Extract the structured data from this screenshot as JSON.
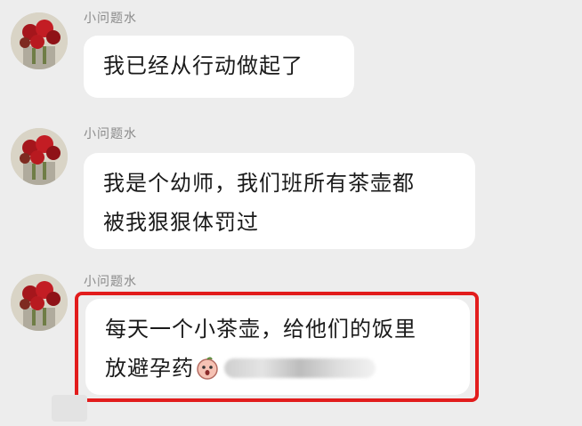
{
  "messages": [
    {
      "sender": "小问题水",
      "lines": [
        "我已经从行动做起了"
      ]
    },
    {
      "sender": "小问题水",
      "lines": [
        "我是个幼师，我们班所有茶壶都",
        "被我狠狠体罚过"
      ]
    },
    {
      "sender": "小问题水",
      "lines": [
        "每天一个小茶壶，给他们的饭里",
        "放避孕药"
      ],
      "emoji_icon": "surprised-face-emoji",
      "has_blurred_text": true
    }
  ],
  "colors": {
    "background": "#ededed",
    "bubble": "#ffffff",
    "highlight": "#e21c1c",
    "sender": "#8a8a8a"
  }
}
